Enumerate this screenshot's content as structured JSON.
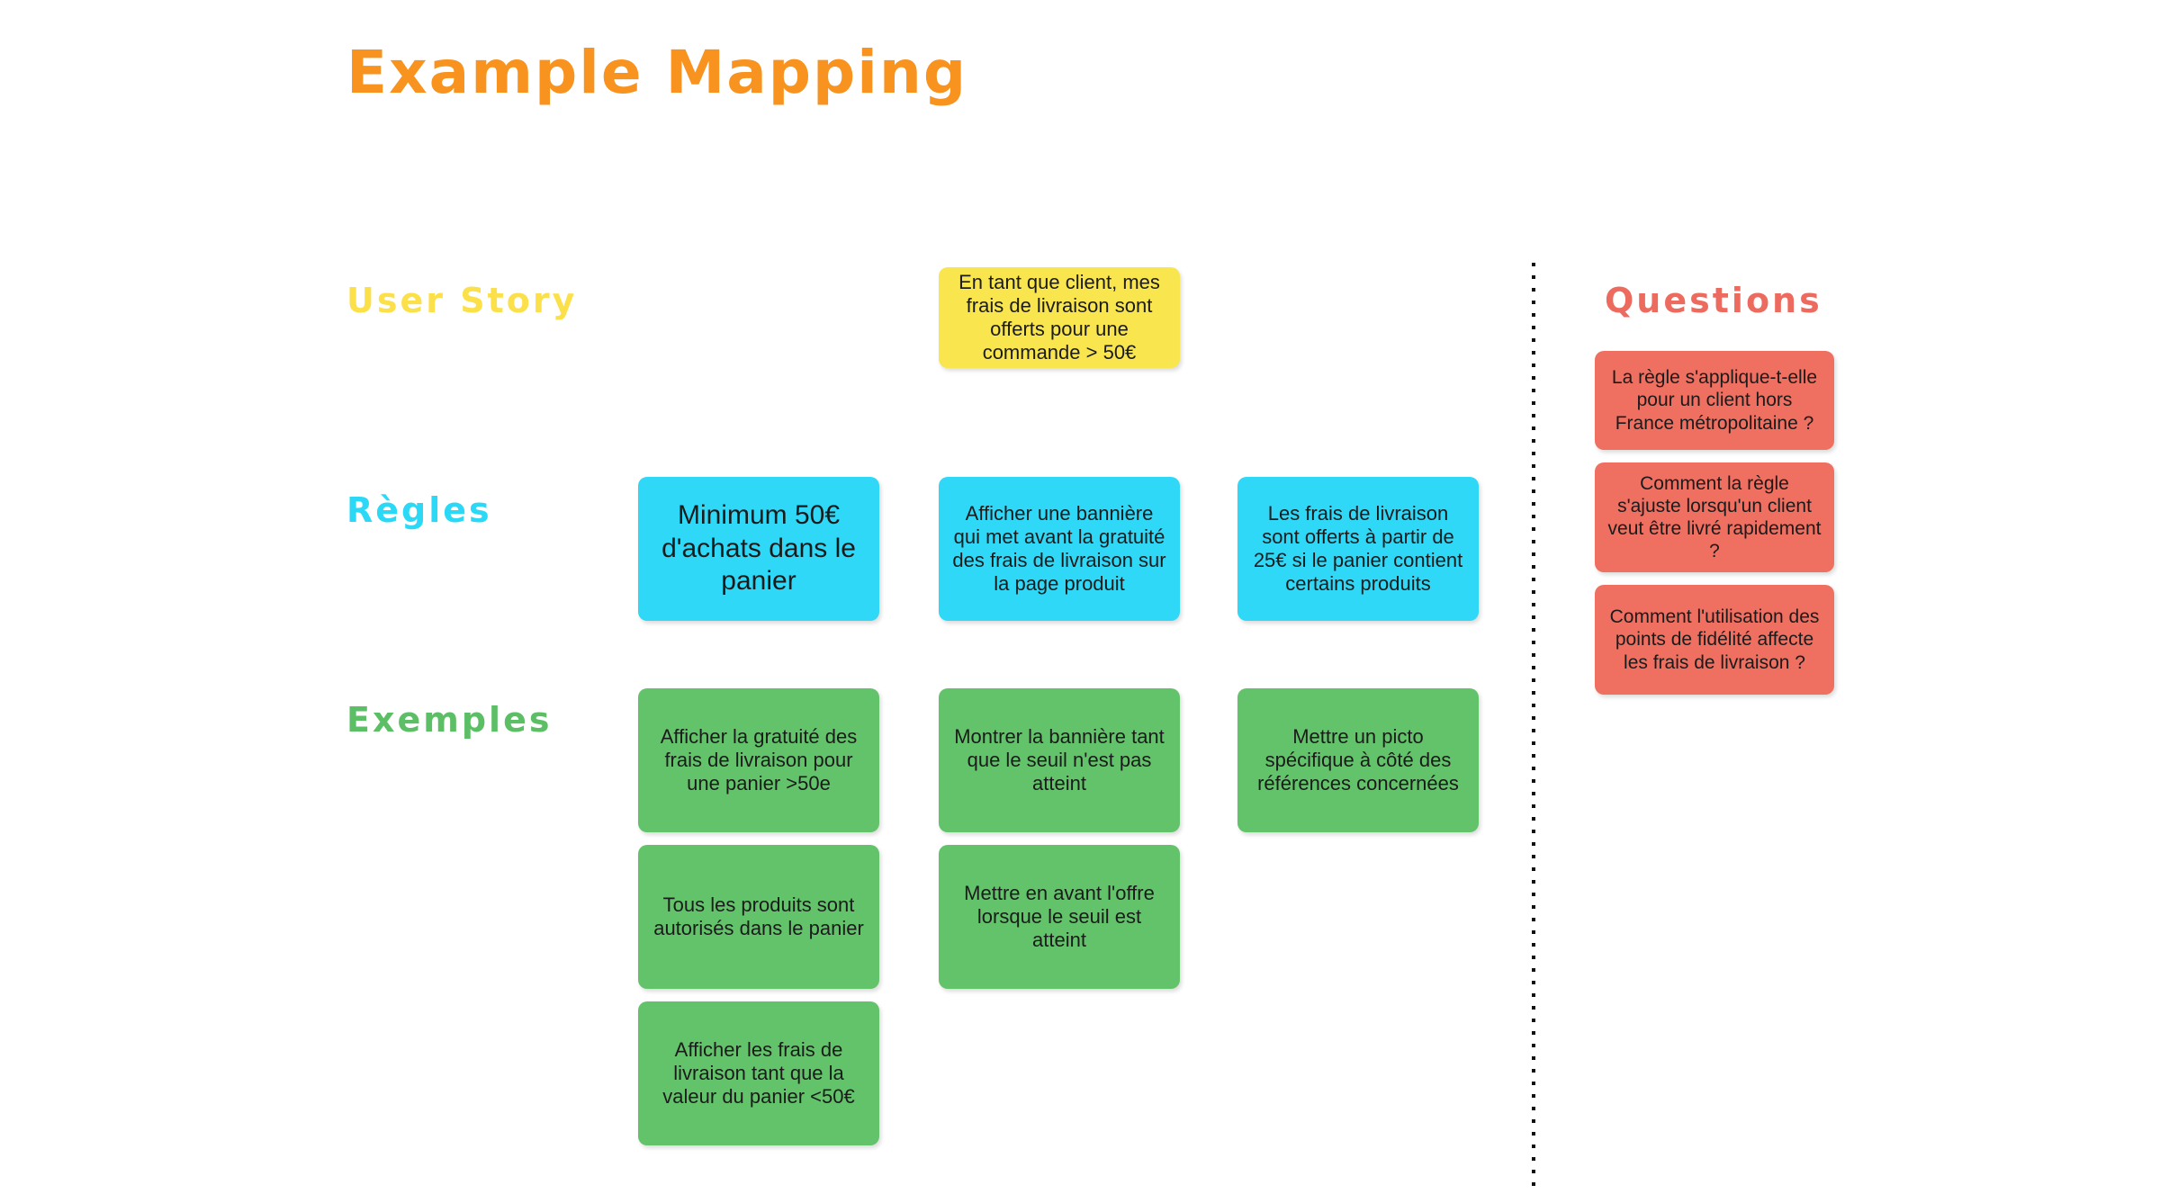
{
  "board": {
    "title": "Example Mapping",
    "title_color": "#F7931E",
    "background": "#FFFFFF"
  },
  "rows": {
    "user_story": {
      "label": "User Story",
      "color": "#FCE04A"
    },
    "rules": {
      "label": "Règles",
      "color": "#2BD9F7"
    },
    "examples": {
      "label": "Exemples",
      "color": "#5CBF66"
    },
    "questions": {
      "label": "Questions",
      "color": "#ED6A5E"
    }
  },
  "cards": {
    "user_story": [
      {
        "text": "En tant que client, mes frais de livraison sont offerts pour une commande > 50€",
        "color": "#F9E64F",
        "column": 2
      }
    ],
    "rules": [
      {
        "text": "Minimum 50€ d'achats dans le panier",
        "color": "#2FD8F7",
        "column": 1
      },
      {
        "text": "Afficher une bannière qui met avant la gratuité des frais de livraison sur la page produit",
        "color": "#2FD8F7",
        "column": 2
      },
      {
        "text": "Les frais de livraison sont offerts à partir de 25€ si le panier contient certains produits",
        "color": "#2FD8F7",
        "column": 3
      }
    ],
    "examples_col_1": [
      {
        "text": "Afficher la gratuité des frais de livraison pour une panier >50e",
        "color": "#63C36B"
      },
      {
        "text": "Tous les produits sont autorisés dans le panier",
        "color": "#63C36B"
      },
      {
        "text": "Afficher les frais de livraison tant que la valeur du panier <50€",
        "color": "#63C36B"
      }
    ],
    "examples_col_2": [
      {
        "text": "Montrer la bannière tant que le seuil n'est pas atteint",
        "color": "#63C36B"
      },
      {
        "text": "Mettre en avant l'offre lorsque le seuil est atteint",
        "color": "#63C36B"
      }
    ],
    "examples_col_3": [
      {
        "text": "Mettre un picto spécifique à côté des références concernées",
        "color": "#63C36B"
      }
    ],
    "questions": [
      {
        "text": "La règle s'applique-t-elle pour un client hors France métropolitaine ?",
        "color": "#EF6F61"
      },
      {
        "text": "Comment la règle s'ajuste lorsqu'un client veut être livré rapidement ?",
        "color": "#EF6F61"
      },
      {
        "text": "Comment l'utilisation des points de fidélité affecte les frais de livraison ?",
        "color": "#EF6F61"
      }
    ]
  }
}
